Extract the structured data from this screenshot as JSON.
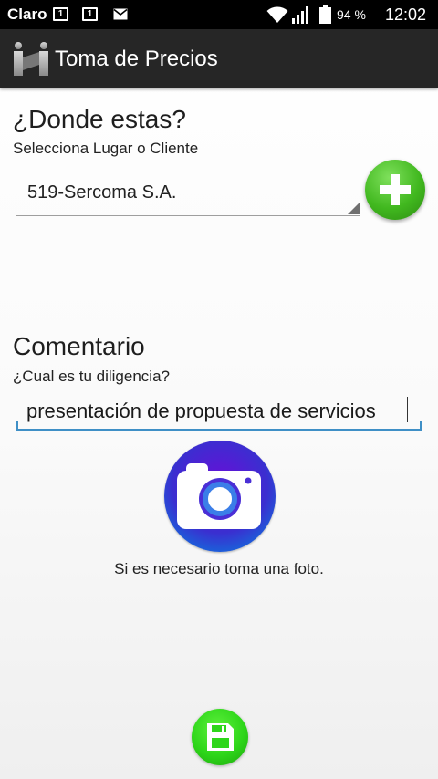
{
  "status_bar": {
    "carrier": "Claro",
    "sim1": "1",
    "sim2": "1",
    "battery_percent": "94 %",
    "time": "12:02",
    "icons": [
      "sim-card-icon",
      "sim-card-icon",
      "mail-icon",
      "wifi-icon",
      "signal-icon",
      "battery-icon"
    ]
  },
  "app_bar": {
    "title": "Toma de Precios",
    "logo_icon": "app-logo-icon"
  },
  "location": {
    "heading": "¿Donde estas?",
    "subheading": "Selecciona Lugar o Cliente",
    "selected": "519-Sercoma S.A.",
    "add_icon": "plus-icon"
  },
  "comment": {
    "heading": "Comentario",
    "subheading": "¿Cual es tu diligencia?",
    "value": "presentación de propuesta de servicios"
  },
  "photo": {
    "icon": "camera-icon",
    "caption": "Si es necesario toma una foto."
  },
  "save": {
    "icon": "save-icon"
  },
  "colors": {
    "status_bar": "#000000",
    "app_bar": "#262626",
    "add_button": "#41b81f",
    "save_button": "#2ed61a",
    "camera_button": "#3a2fd0",
    "input_underline": "#3f8fc6"
  }
}
